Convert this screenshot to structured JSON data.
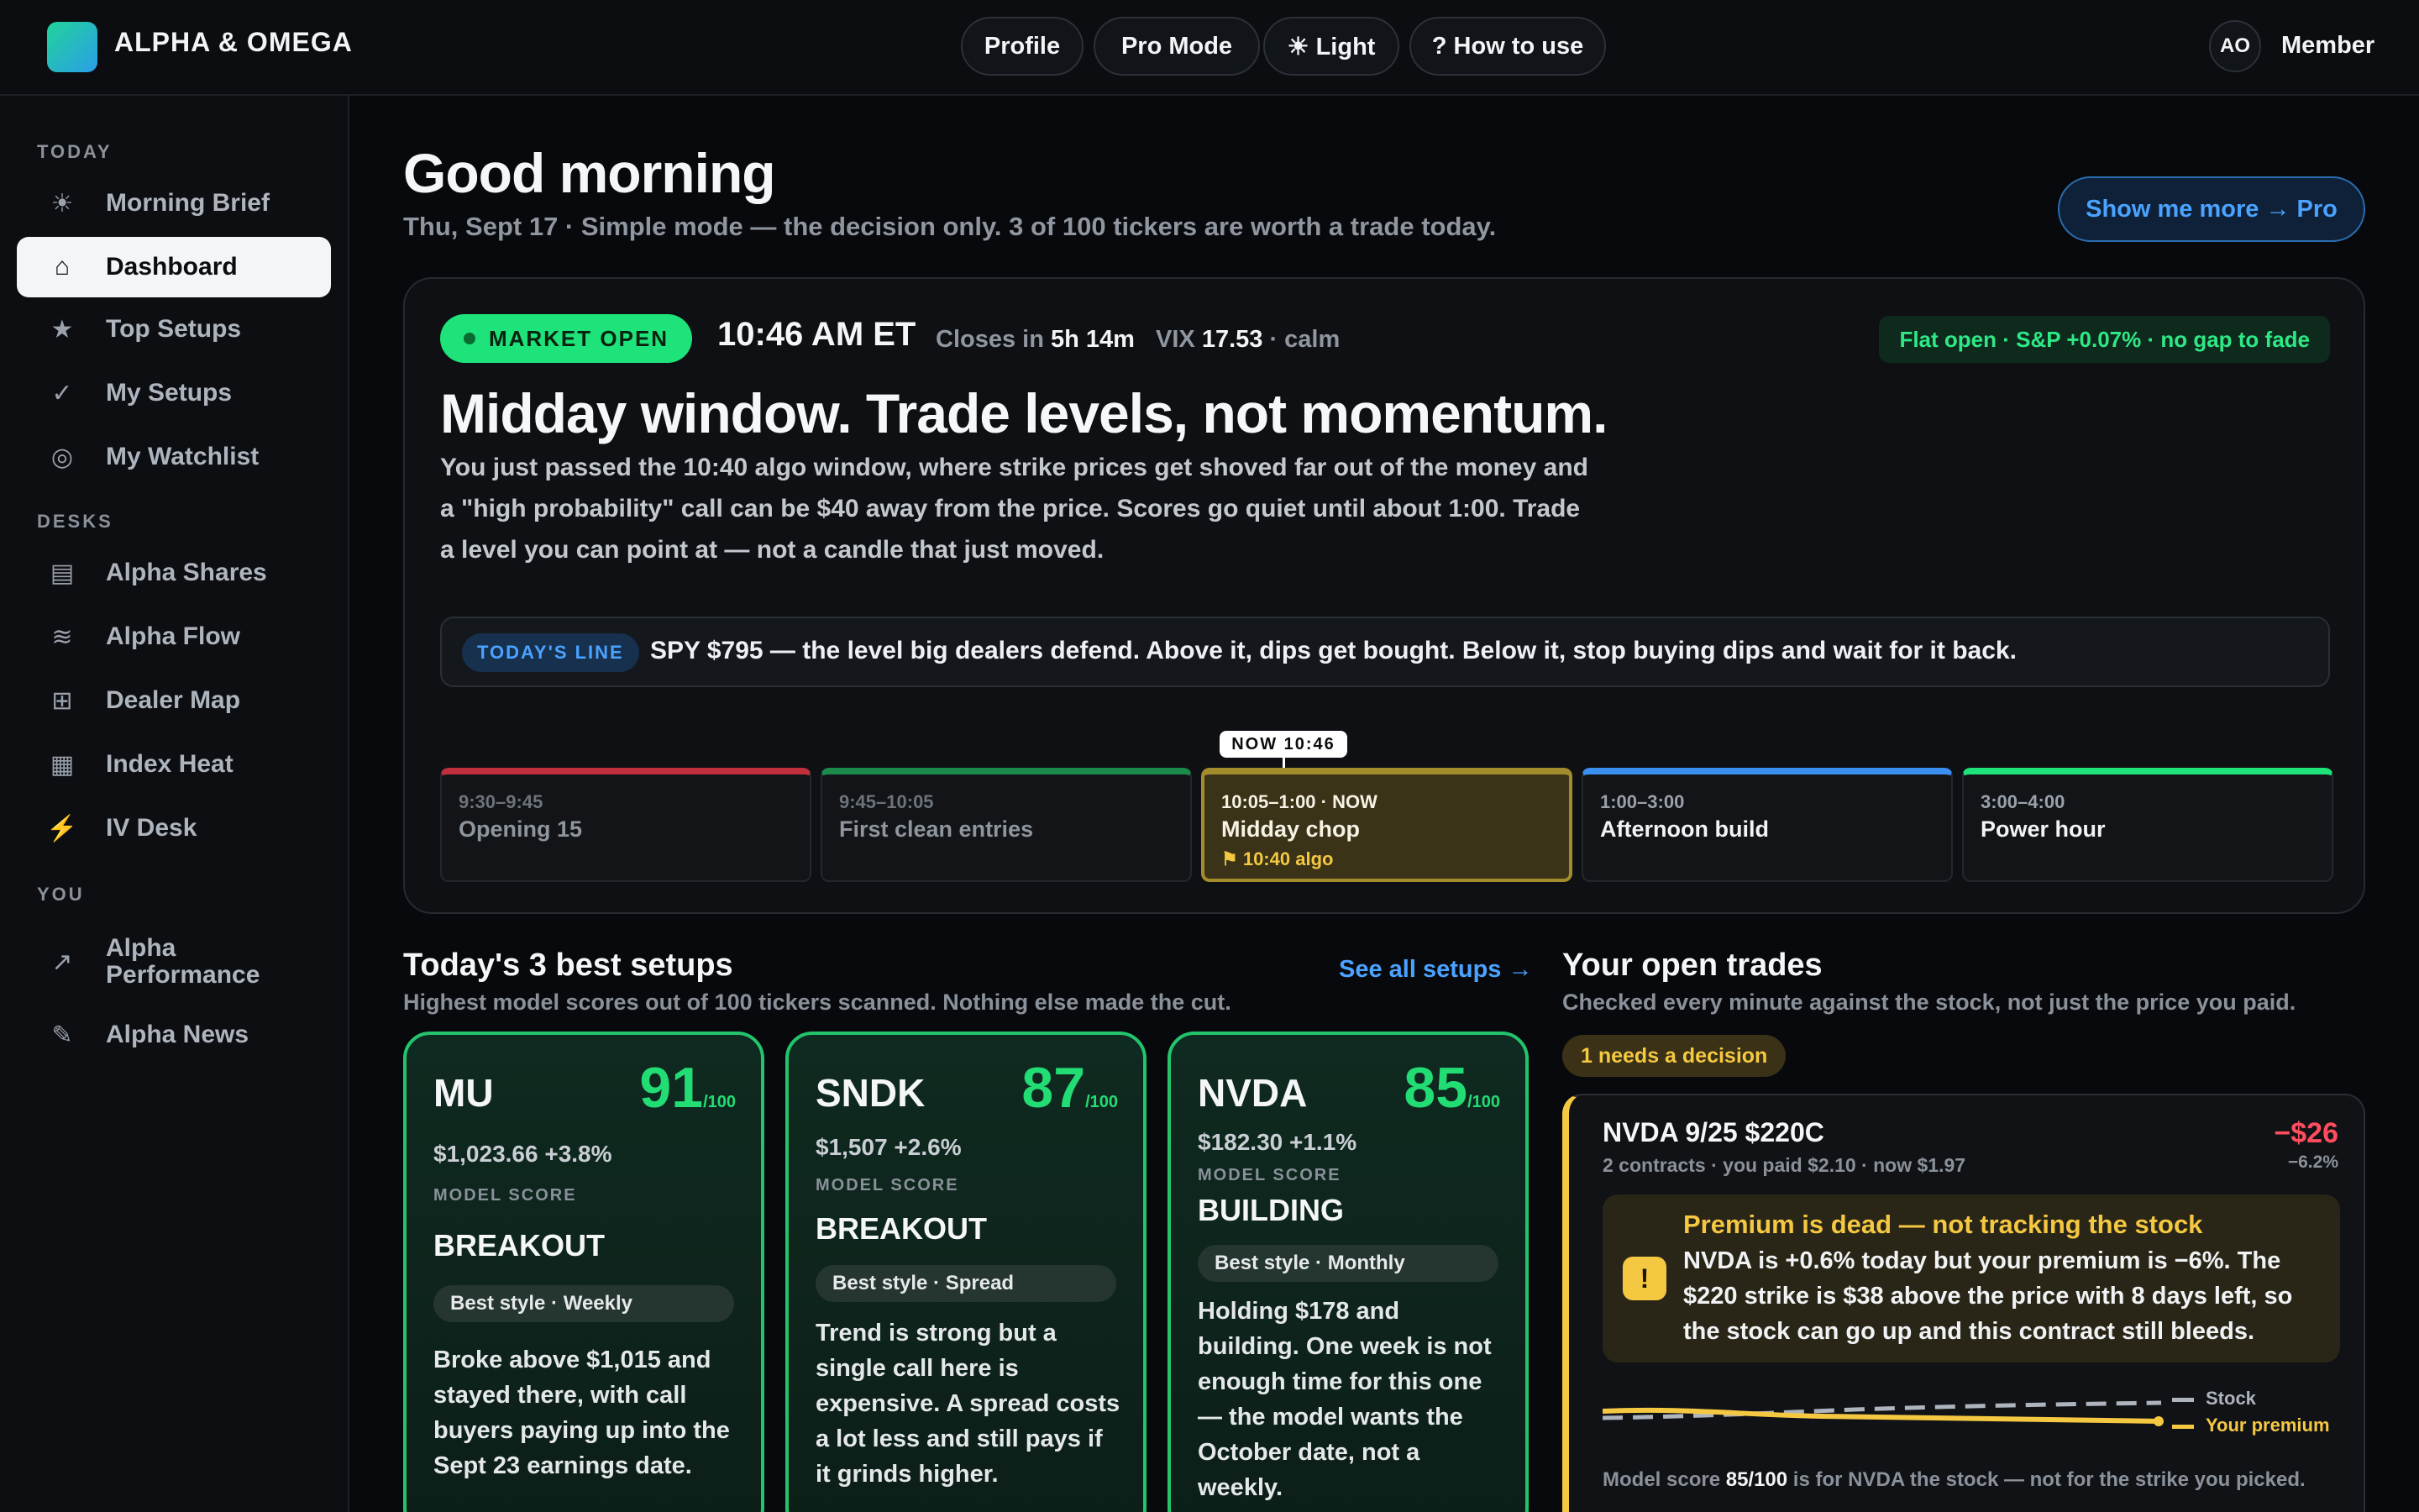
{
  "app": {
    "brand": "ALPHA & OMEGA"
  },
  "topnav": {
    "profile": "Profile",
    "pro_mode": "Pro Mode",
    "light": "☀ Light",
    "how_to": "? How to use",
    "avatar": "AO",
    "member": "Member"
  },
  "sidebar": {
    "sections": {
      "today": "TODAY",
      "desks": "DESKS",
      "you": "YOU"
    },
    "items": [
      {
        "label": "Morning Brief",
        "icon": "☀"
      },
      {
        "label": "Dashboard",
        "icon": "⌂"
      },
      {
        "label": "Top Setups",
        "icon": "★"
      },
      {
        "label": "My Setups",
        "icon": "✓"
      },
      {
        "label": "My Watchlist",
        "icon": "◎"
      },
      {
        "label": "Alpha Shares",
        "icon": "▤"
      },
      {
        "label": "Alpha Flow",
        "icon": "≋"
      },
      {
        "label": "Dealer Map",
        "icon": "⊞"
      },
      {
        "label": "Index Heat",
        "icon": "▦"
      },
      {
        "label": "IV Desk",
        "icon": "⚡"
      },
      {
        "label": "Alpha Performance",
        "icon": "↗"
      },
      {
        "label": "Alpha News",
        "icon": "✎"
      }
    ],
    "active": "Dashboard"
  },
  "header": {
    "greeting": "Good morning",
    "subtitle": "Thu, Sept 17 · Simple mode — the decision only. 3 of 100 tickers are worth a trade today.",
    "pro_button": "Show me more → Pro"
  },
  "market": {
    "status": "MARKET OPEN",
    "time": "10:46 AM ET",
    "closes_label": "Closes in",
    "closes_value": "5h 14m",
    "vix_label": "VIX",
    "vix_value": "17.53",
    "vix_note": "· calm",
    "flat_open": "Flat open · S&P  +0.07%  · no gap to fade",
    "headline": "Midday window. Trade levels, not momentum.",
    "body": "You just passed the 10:40 algo window, where strike prices get shoved far out of the money and a \"high probability\" call can be $40 away from the price. Scores go quiet until about 1:00. Trade a level you can point at — not a candle that just moved.",
    "line_tag": "TODAY'S LINE",
    "line_text": "SPY $795 — the level big dealers defend. Above it, dips get bought. Below it, stop buying dips and wait for it back.",
    "now_tag": "NOW 10:46",
    "timeline": [
      {
        "time": "9:30–9:45",
        "name": "Opening 15",
        "color": "#c0303c",
        "state": "past"
      },
      {
        "time": "9:45–10:05",
        "name": "First clean entries",
        "color": "#1c8a4a",
        "state": "past"
      },
      {
        "time": "10:05–1:00 · NOW",
        "name": "Midday chop",
        "color": "#a38c2c",
        "state": "now",
        "note": "⚑ 10:40 algo"
      },
      {
        "time": "1:00–3:00",
        "name": "Afternoon build",
        "color": "#3b8ff0",
        "state": "future"
      },
      {
        "time": "3:00–4:00",
        "name": "Power hour",
        "color": "#1ee37a",
        "state": "future"
      }
    ]
  },
  "setups": {
    "title": "Today's 3 best setups",
    "subtitle": "Highest model scores out of 100 tickers scanned. Nothing else made the cut.",
    "see_all": "See all setups →",
    "model_score_label": "MODEL SCORE",
    "score_suffix": "/100",
    "cards": [
      {
        "ticker": "MU",
        "score": "91",
        "price": "$1,023.66 +3.8%",
        "signal": "BREAKOUT",
        "style": "Best style · Weekly",
        "desc": "Broke above $1,015 and stayed there, with call buyers paying up into the Sept 23 earnings date."
      },
      {
        "ticker": "SNDK",
        "score": "87",
        "price": "$1,507 +2.6%",
        "signal": "BREAKOUT",
        "style": "Best style · Spread",
        "desc": "Trend is strong but a single call here is expensive. A spread costs a lot less and still pays if it grinds higher."
      },
      {
        "ticker": "NVDA",
        "score": "85",
        "price": "$182.30 +1.1%",
        "signal": "BUILDING",
        "style": "Best style · Monthly",
        "desc": "Holding $178 and building. One week is not enough time for this one — the model wants the October date, not a weekly."
      }
    ]
  },
  "trades": {
    "title": "Your open trades",
    "subtitle": "Checked every minute against the stock, not just the price you paid.",
    "needs": "1 needs a decision",
    "trade": {
      "name": "NVDA 9/25 $220C",
      "meta": "2 contracts · you paid $2.10 · now $1.97",
      "pnl": "−$26",
      "pnl_pct": "−6.2%",
      "warn_title": "Premium is dead — not tracking the stock",
      "warn_body": "NVDA is +0.6% today but your premium is −6%. The $220 strike is $38 above the price with 8 days left, so the stock can go up and this contract still bleeds.",
      "legend_stock": "Stock",
      "legend_premium": "Your premium",
      "foot_pre": "Model score",
      "foot_score": "85/100",
      "foot_post": "is for NVDA the stock — not for the strike you picked."
    }
  },
  "colors": {
    "accent_green": "#1ee37a",
    "accent_blue": "#4aa3ff",
    "warn_yellow": "#f5c842",
    "loss_red": "#ff4d5e"
  }
}
